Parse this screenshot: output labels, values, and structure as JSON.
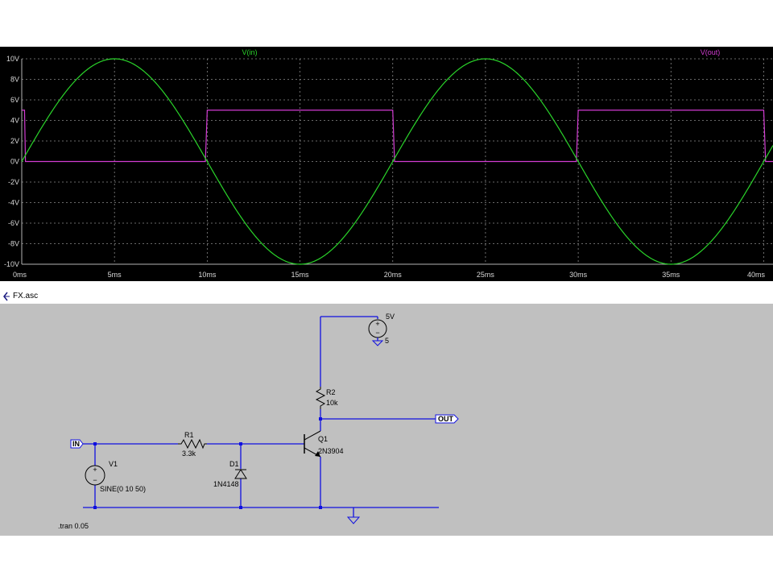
{
  "plot": {
    "background": "#000000",
    "traces": [
      {
        "label": "V(in)",
        "color": "#2ad42a"
      },
      {
        "label": "V(out)",
        "color": "#d23cd2"
      }
    ],
    "y_ticks": [
      "10V",
      "8V",
      "6V",
      "4V",
      "2V",
      "0V",
      "-2V",
      "-4V",
      "-6V",
      "-8V",
      "-10V"
    ],
    "x_ticks": [
      "0ms",
      "5ms",
      "10ms",
      "15ms",
      "20ms",
      "25ms",
      "30ms",
      "35ms",
      "40ms"
    ],
    "tick_color": "#d8d8d8",
    "grid_color": "#8a8a8a"
  },
  "chart_data": {
    "type": "line",
    "title": "",
    "xlabel": "",
    "ylabel": "",
    "xlim": [
      0,
      40.5
    ],
    "ylim": [
      -10,
      10
    ],
    "grid": true,
    "legend": "top",
    "series": [
      {
        "name": "V(in)",
        "function": "10*sin(2*pi*50*t)",
        "amplitude": 10,
        "frequency_hz": 50,
        "color": "#2ad42a"
      },
      {
        "name": "V(out)",
        "x": [
          0,
          0.15,
          0.2,
          9.9,
          10,
          20,
          20.1,
          29.9,
          30,
          40,
          40.1,
          40.5
        ],
        "y": [
          5,
          5,
          0,
          0,
          5,
          5,
          0,
          0,
          5,
          5,
          0,
          0
        ],
        "color": "#d23cd2"
      }
    ]
  },
  "schematic": {
    "file_name": "FX.asc",
    "wire_color": "#1010e0",
    "labels": {
      "in_port": "IN",
      "out_port": "OUT",
      "v1_name": "V1",
      "v1_value": "SINE(0 10 50)",
      "r1_name": "R1",
      "r1_value": "3.3k",
      "d1_name": "D1",
      "d1_value": "1N4148",
      "q1_name": "Q1",
      "q1_value": "2N3904",
      "r2_name": "R2",
      "r2_value": "10k",
      "vcc_name": "5V",
      "vcc_value": "5",
      "directive": ".tran 0.05"
    }
  }
}
